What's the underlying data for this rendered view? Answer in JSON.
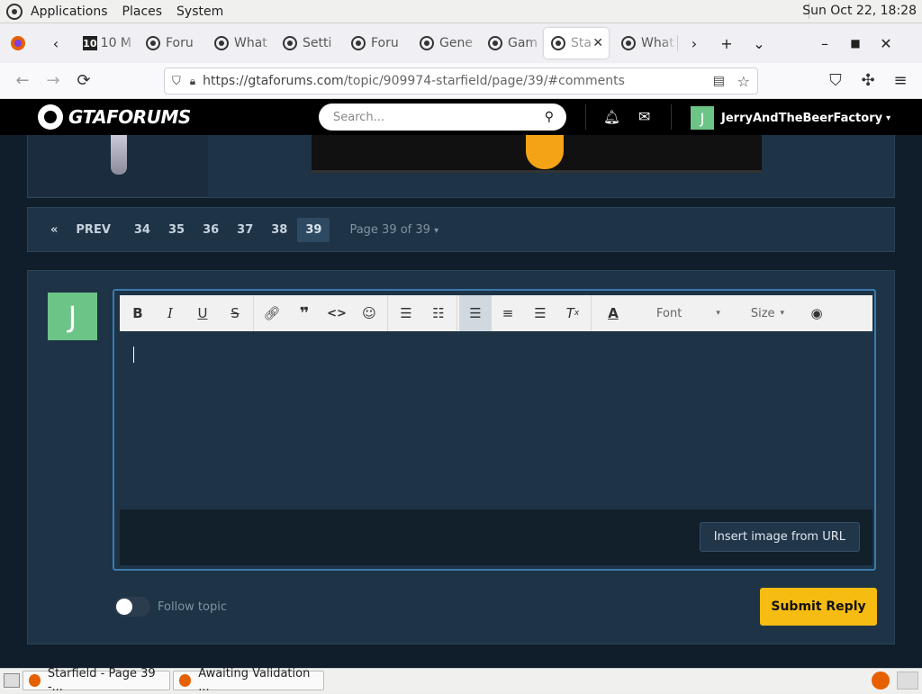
{
  "desktop": {
    "menu": [
      "Applications",
      "Places",
      "System"
    ],
    "clock": "Sun Oct 22, 18:28"
  },
  "tabs": [
    {
      "label": "10 M",
      "icon": "ten-favicon"
    },
    {
      "label": "Foru",
      "icon": "gtaforums-favicon"
    },
    {
      "label": "What",
      "icon": "gtaforums-favicon"
    },
    {
      "label": "Setti",
      "icon": "gtaforums-favicon"
    },
    {
      "label": "Foru",
      "icon": "gtaforums-favicon"
    },
    {
      "label": "Gene",
      "icon": "gtaforums-favicon"
    },
    {
      "label": "Gam",
      "icon": "gtaforums-favicon"
    },
    {
      "label": "Sta",
      "icon": "gtaforums-favicon",
      "active": true
    },
    {
      "label": "What",
      "icon": "gtaforums-favicon"
    }
  ],
  "browser": {
    "url_host": "https://gtaforums.com",
    "url_path": "/topic/909974-starfield/page/39/#comments"
  },
  "site": {
    "brand": "GTAFORUMS",
    "search_placeholder": "Search...",
    "user_initial": "J",
    "username": "JerryAndTheBeerFactory",
    "username_caret": "▾"
  },
  "pagination": {
    "first": "«",
    "prev": "PREV",
    "pages": [
      "34",
      "35",
      "36",
      "37",
      "38",
      "39"
    ],
    "current": "39",
    "info": "Page 39 of 39",
    "info_caret": "▾"
  },
  "editor": {
    "avatar_initial": "J",
    "font_label": "Font",
    "size_label": "Size",
    "insert_image": "Insert image from URL",
    "follow_label": "Follow topic",
    "follow_on": false,
    "submit": "Submit Reply"
  },
  "colors": {
    "accent": "#f7bc12",
    "avatar": "#6cc486",
    "page_bg": "#0f1e2a",
    "panel_bg": "#1e3346"
  },
  "taskbar": [
    {
      "label": "Starfield - Page 39 -..."
    },
    {
      "label": "Awaiting Validation ..."
    }
  ]
}
